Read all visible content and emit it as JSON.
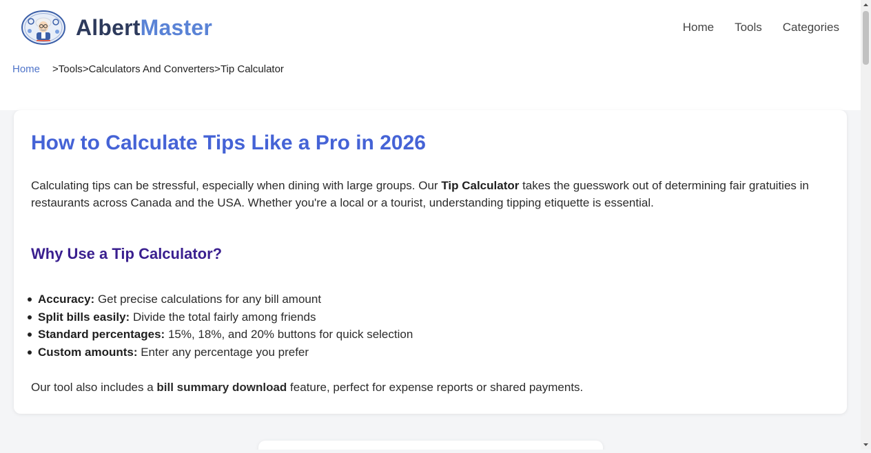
{
  "brand": {
    "part1": "Albert",
    "part2": "Master"
  },
  "nav": {
    "items": [
      "Home",
      "Tools",
      "Categories"
    ]
  },
  "breadcrumb": {
    "home": "Home",
    "separator": ">",
    "items": [
      "Tools",
      "Calculators And Converters",
      "Tip Calculator"
    ]
  },
  "article": {
    "title": "How to Calculate Tips Like a Pro in 2026",
    "intro": {
      "pre": "Calculating tips can be stressful, especially when dining with large groups. Our ",
      "bold": "Tip Calculator",
      "post": " takes the guesswork out of determining fair gratuities in restaurants across Canada and the USA. Whether you're a local or a tourist, understanding tipping etiquette is essential."
    },
    "subtitle": "Why Use a Tip Calculator?",
    "bullets": [
      {
        "bold": "Accuracy:",
        "text": " Get precise calculations for any bill amount"
      },
      {
        "bold": "Split bills easily:",
        "text": " Divide the total fairly among friends"
      },
      {
        "bold": "Standard percentages:",
        "text": " 15%, 18%, and 20% buttons for quick selection"
      },
      {
        "bold": "Custom amounts:",
        "text": " Enter any percentage you prefer"
      }
    ],
    "outro": {
      "pre": "Our tool also includes a ",
      "bold": "bill summary download",
      "post": " feature, perfect for expense reports or shared payments."
    }
  },
  "colors": {
    "title": "#4563d6",
    "subtitle": "#3a1f8f",
    "brand_dark": "#2d3a5c",
    "brand_light": "#5a83d6",
    "link": "#4f74c9"
  },
  "icons": {
    "logo": "albert-einstein-avatar-logo"
  }
}
